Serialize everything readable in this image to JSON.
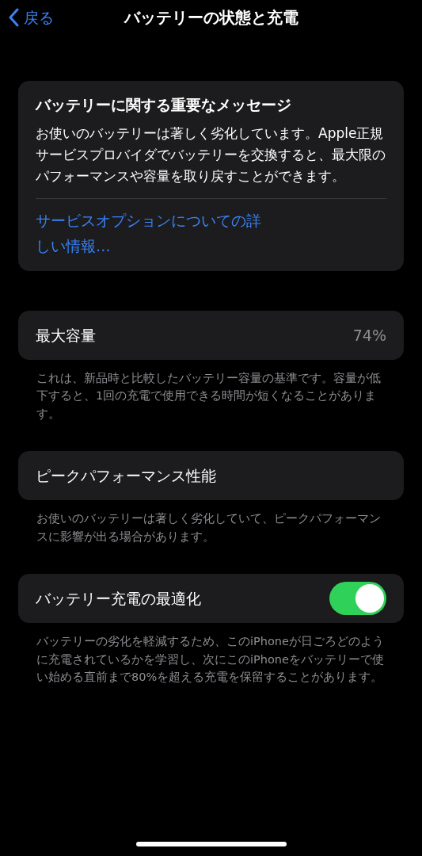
{
  "nav": {
    "back": "戻る",
    "title": "バッテリーの状態と充電"
  },
  "message": {
    "title": "バッテリーに関する重要なメッセージ",
    "body": "お使いのバッテリーは著しく劣化しています。Apple正規サービスプロバイダでバッテリーを交換すると、最大限のパフォーマンスや容量を取り戻すことができます。",
    "link": "サービスオプションについての詳しい情報…"
  },
  "rows": [
    {
      "kind": "value",
      "label": "最大容量",
      "value": "74%",
      "footer": "これは、新品時と比較したバッテリー容量の基準です。容量が低下すると、1回の充電で使用できる時間が短くなることがあります。"
    },
    {
      "kind": "plain",
      "label": "ピークパフォーマンス性能",
      "footer": "お使いのバッテリーは著しく劣化していて、ピークパフォーマンスに影響が出る場合があります。"
    },
    {
      "kind": "toggle",
      "label": "バッテリー充電の最適化",
      "on": true,
      "footer": "バッテリーの劣化を軽減するため、このiPhoneが日ごろどのように充電されているかを学習し、次にこのiPhoneをバッテリーで使い始める直前まで80%を超える充電を保留することがあります。"
    }
  ]
}
